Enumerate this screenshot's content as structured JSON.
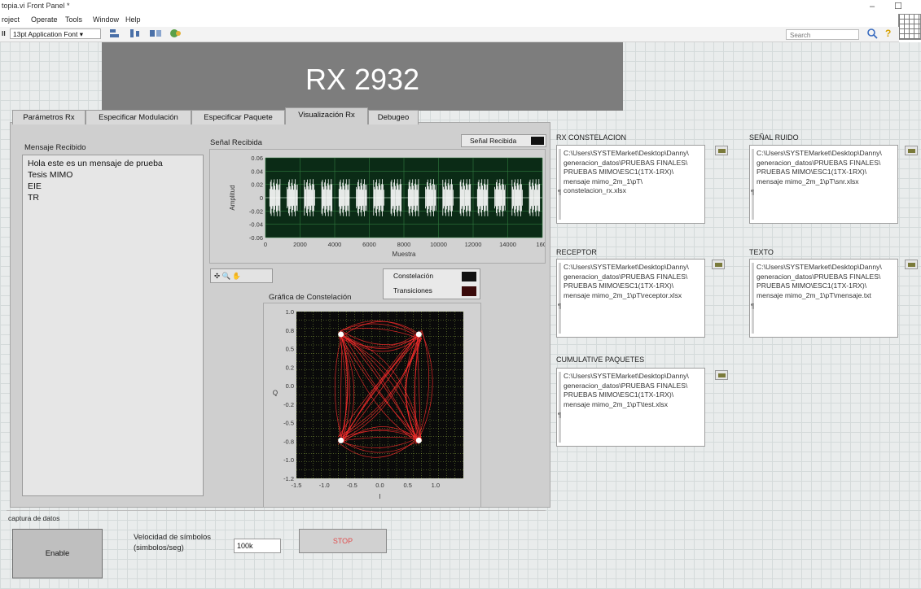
{
  "window": {
    "title": "topia.vi Front Panel *",
    "min_label": "–",
    "max_label": "☐"
  },
  "menu": [
    "roject",
    "Operate",
    "Tools",
    "Window",
    "Help"
  ],
  "toolbar": {
    "run_label": "II",
    "font": "13pt Application Font",
    "search_placeholder": "Search"
  },
  "banner": {
    "title": "RX 2932"
  },
  "tabs": [
    {
      "label": "Parámetros Rx",
      "active": false
    },
    {
      "label": "Especificar Modulación",
      "active": false
    },
    {
      "label": "Especificar Paquete",
      "active": false
    },
    {
      "label": "Visualización Rx",
      "active": true
    },
    {
      "label": "Debugeo",
      "active": false
    }
  ],
  "message": {
    "label": "Mensaje Recibido",
    "lines": [
      "Hola este es un mensaje de prueba",
      "Tesis MIMO",
      "EIE",
      "TR"
    ]
  },
  "chart_data": [
    {
      "type": "line",
      "title": "Señal Recibida",
      "xlabel": "Muestra",
      "ylabel": "Amplitud",
      "xlim": [
        0,
        16000
      ],
      "ylim": [
        -0.06,
        0.06
      ],
      "x_ticks": [
        "0",
        "2000",
        "4000",
        "6000",
        "8000",
        "10000",
        "12000",
        "14000",
        "160("
      ],
      "y_ticks": [
        "0.06",
        "0.04",
        "0.02",
        "0",
        "-0.02",
        "-0.04",
        "-0.06"
      ],
      "legend": [
        "Señal Recibida"
      ],
      "burst_count": 16,
      "colors": {
        "plot_bg": "#0b2b16",
        "trace": "#ffffff",
        "grid": "#2f7a3e"
      }
    },
    {
      "type": "scatter",
      "title": "Gráfica de Constelación",
      "xlabel": "I",
      "ylabel": "Q",
      "xlim": [
        -1.5,
        1.5
      ],
      "ylim": [
        -1.2,
        1.0
      ],
      "x_ticks": [
        "-1.5",
        "-1.0",
        "-0.5",
        "0.0",
        "0.5",
        "1.0"
      ],
      "y_ticks": [
        "1.0",
        "0.8",
        "0.5",
        "0.2",
        "0.0",
        "-0.2",
        "-0.5",
        "-0.8",
        "-1.0",
        "-1.2"
      ],
      "legend": [
        "Constelación",
        "Transiciones"
      ],
      "points": [
        [
          -0.7,
          0.7
        ],
        [
          0.7,
          0.7
        ],
        [
          -0.7,
          -0.7
        ],
        [
          0.7,
          -0.7
        ]
      ],
      "colors": {
        "plot_bg": "#0a0a0a",
        "trace": "#ff2d2d",
        "grid": "#a7c94a",
        "points": "#ffffff"
      }
    }
  ],
  "palette": {
    "label": "✣ 🔍 ✋"
  },
  "paths": [
    {
      "label": "RX CONSTELACION",
      "lines": [
        "C:\\Users\\SYSTEMarket\\Desktop\\Danny\\",
        "generacion_datos\\PRUEBAS FINALES\\",
        "PRUEBAS MIMO\\ESC1(1TX-1RX)\\",
        "mensaje mimo_2m_1\\pT\\",
        "constelacion_rx.xlsx"
      ]
    },
    {
      "label": "SEÑAL RUIDO",
      "lines": [
        "C:\\Users\\SYSTEMarket\\Desktop\\Danny\\",
        "generacion_datos\\PRUEBAS FINALES\\",
        "PRUEBAS MIMO\\ESC1(1TX-1RX)\\",
        "mensaje mimo_2m_1\\pT\\snr.xlsx"
      ]
    },
    {
      "label": "RECEPTOR",
      "lines": [
        "C:\\Users\\SYSTEMarket\\Desktop\\Danny\\",
        "generacion_datos\\PRUEBAS FINALES\\",
        "PRUEBAS MIMO\\ESC1(1TX-1RX)\\",
        "mensaje mimo_2m_1\\pT\\receptor.xlsx"
      ]
    },
    {
      "label": "TEXTO",
      "lines": [
        "C:\\Users\\SYSTEMarket\\Desktop\\Danny\\",
        "generacion_datos\\PRUEBAS FINALES\\",
        "PRUEBAS MIMO\\ESC1(1TX-1RX)\\",
        "mensaje mimo_2m_1\\pT\\mensaje.txt"
      ]
    },
    {
      "label": "CUMULATIVE PAQUETES",
      "lines": [
        "C:\\Users\\SYSTEMarket\\Desktop\\Danny\\",
        "generacion_datos\\PRUEBAS FINALES\\",
        "PRUEBAS MIMO\\ESC1(1TX-1RX)\\",
        "mensaje mimo_2m_1\\pT\\test.xlsx"
      ]
    }
  ],
  "capture": {
    "label": "captura de datos",
    "enable_label": "Enable",
    "speed_label_1": "Velocidad de símbolos",
    "speed_label_2": "(simbolos/seg)",
    "speed_value": "100k",
    "stop_label": "STOP"
  }
}
